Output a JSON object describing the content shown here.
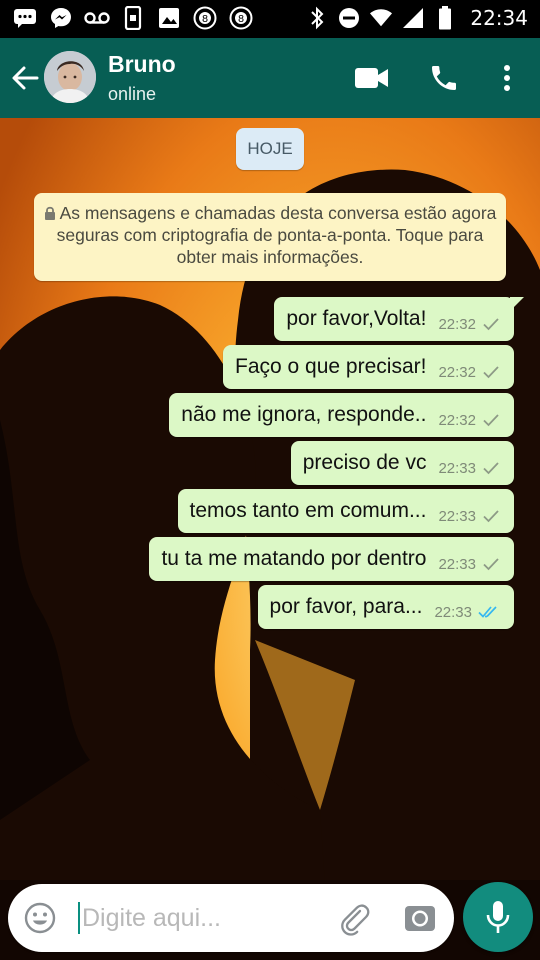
{
  "status_bar": {
    "time": "22:34",
    "left_icons": [
      "chat-bubble-icon",
      "messenger-icon",
      "voicemail-icon",
      "phone-data-icon",
      "gallery-icon",
      "pool-ball-8-icon",
      "pool-ball-8-icon"
    ],
    "right_icons": [
      "bluetooth-icon",
      "do-not-disturb-icon",
      "wifi-icon",
      "signal-icon",
      "battery-icon"
    ]
  },
  "header": {
    "contact_name": "Bruno",
    "contact_status": "online",
    "icons": [
      "back-arrow-icon",
      "video-call-icon",
      "phone-icon",
      "more-vert-icon"
    ]
  },
  "chat": {
    "date_chip": "HOJE",
    "e2e_notice": "As mensagens e chamadas desta conversa estão agora seguras com criptografia de ponta-a-ponta. Toque para obter mais informações.",
    "messages": [
      {
        "text": "por favor,Volta!",
        "time": "22:32",
        "status": "sent"
      },
      {
        "text": "Faço o que precisar!",
        "time": "22:32",
        "status": "sent"
      },
      {
        "text": "não me ignora, responde..",
        "time": "22:32",
        "status": "sent"
      },
      {
        "text": "preciso de vc",
        "time": "22:33",
        "status": "sent"
      },
      {
        "text": "temos tanto em comum...",
        "time": "22:33",
        "status": "sent"
      },
      {
        "text": "tu ta me matando por dentro",
        "time": "22:33",
        "status": "sent"
      },
      {
        "text": "por favor, para...",
        "time": "22:33",
        "status": "read"
      }
    ]
  },
  "composer": {
    "placeholder": "Digite aqui..."
  },
  "colors": {
    "header": "#075e54",
    "outgoing_bubble": "#dcf8c6",
    "mic_button": "#128c7e",
    "read_tick": "#34b7f1",
    "sent_tick": "#8d9a86"
  }
}
